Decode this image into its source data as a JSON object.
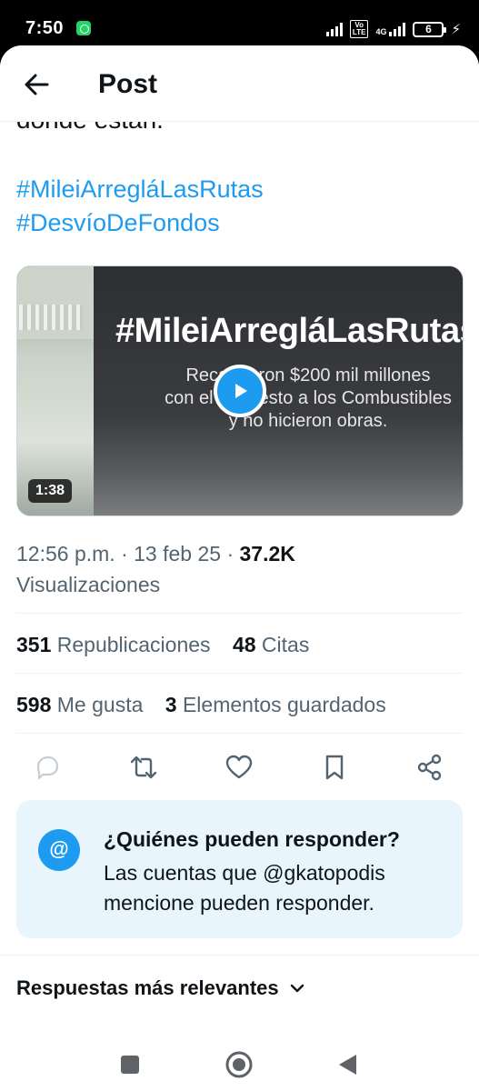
{
  "status_bar": {
    "time": "7:50",
    "volte_label": "Vo\nLTE",
    "network_label": "4G",
    "battery": "6"
  },
  "header": {
    "title": "Post"
  },
  "tweet": {
    "partial_text": "donde están.",
    "hashtags": [
      "#MileiArregláLasRutas",
      "#DesvíoDeFondos"
    ],
    "video": {
      "banner_title": "#MileiArregláLasRutas",
      "banner_line1": "Recaudaron $200 mil millones",
      "banner_line2": "con el Impuesto a los Combustibles",
      "banner_line3": "y no hicieron obras.",
      "duration": "1:38"
    },
    "time": "12:56 p.m.",
    "date": "13 feb 25",
    "views_count": "37.2K",
    "views_label": "Visualizaciones",
    "reposts_count": "351",
    "reposts_label": "Republicaciones",
    "quotes_count": "48",
    "quotes_label": "Citas",
    "likes_count": "598",
    "likes_label": "Me gusta",
    "bookmarks_count": "3",
    "bookmarks_label": "Elementos guardados"
  },
  "reply_restriction": {
    "title": "¿Quiénes pueden responder?",
    "description": "Las cuentas que @gkatopodis mencione pueden responder."
  },
  "replies_sort": {
    "label": "Respuestas más relevantes"
  },
  "colors": {
    "accent": "#1d9bf0",
    "text_primary": "#0f1419",
    "text_secondary": "#536471",
    "reply_box_bg": "#e8f5fd"
  }
}
